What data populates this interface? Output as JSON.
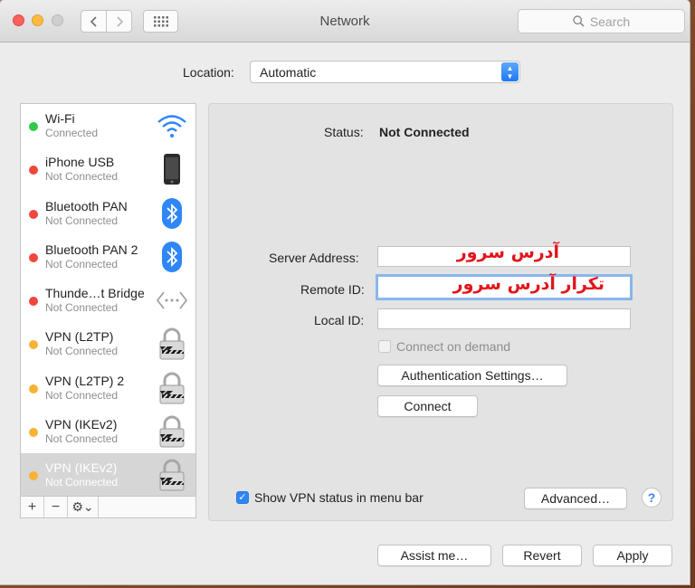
{
  "window": {
    "title": "Network",
    "search_placeholder": "Search"
  },
  "location": {
    "label": "Location:",
    "value": "Automatic"
  },
  "services": [
    {
      "name": "Wi-Fi",
      "status": "Connected",
      "dot": "#33c848",
      "icon": "wifi-icon"
    },
    {
      "name": "iPhone USB",
      "status": "Not Connected",
      "dot": "#f0463e",
      "icon": "iphone-icon"
    },
    {
      "name": "Bluetooth PAN",
      "status": "Not Connected",
      "dot": "#f0463e",
      "icon": "bluetooth-icon"
    },
    {
      "name": "Bluetooth PAN 2",
      "status": "Not Connected",
      "dot": "#f0463e",
      "icon": "bluetooth-icon"
    },
    {
      "name": "Thunde…t Bridge",
      "status": "Not Connected",
      "dot": "#f0463e",
      "icon": "thunderbolt-bridge-icon"
    },
    {
      "name": "VPN (L2TP)",
      "status": "Not Connected",
      "dot": "#f7b334",
      "icon": "lock-icon"
    },
    {
      "name": "VPN (L2TP) 2",
      "status": "Not Connected",
      "dot": "#f7b334",
      "icon": "lock-icon"
    },
    {
      "name": "VPN (IKEv2)",
      "status": "Not Connected",
      "dot": "#f7b334",
      "icon": "lock-icon"
    },
    {
      "name": "VPN (IKEv2)",
      "status": "Not Connected",
      "dot": "#f7b334",
      "icon": "lock-icon"
    }
  ],
  "sidebar_footer": {
    "add": "+",
    "remove": "−",
    "gear": "⚙⌄"
  },
  "detail": {
    "status_label": "Status:",
    "status_value": "Not Connected",
    "server_label": "Server Address:",
    "server_value": "آدرس سرور",
    "remote_label": "Remote ID:",
    "remote_value": "تکرار آدرس سرور",
    "local_label": "Local ID:",
    "local_value": "",
    "connect_on_demand": "Connect on demand",
    "auth_button": "Authentication Settings…",
    "connect_button": "Connect",
    "show_status": "Show VPN status in menu bar",
    "advanced_button": "Advanced…",
    "help": "?"
  },
  "footer": {
    "assist": "Assist me…",
    "revert": "Revert",
    "apply": "Apply"
  }
}
